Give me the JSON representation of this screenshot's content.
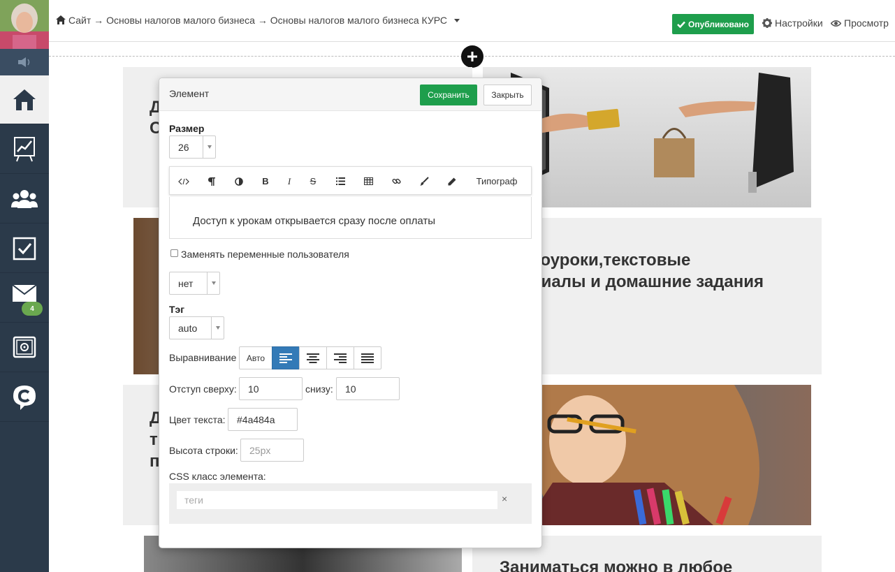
{
  "breadcrumb": {
    "home_icon": "home-icon",
    "path": "Сайт → Основы налогов малого бизнеса → Основы налогов малого бизнеса КУРС"
  },
  "header": {
    "published_label": "Опубликовано",
    "settings_label": "Настройки",
    "preview_label": "Просмотр"
  },
  "sidebar": {
    "mail_badge": "4",
    "items": [
      "home-icon",
      "chart-icon",
      "users-icon",
      "tasks-icon",
      "mail-icon",
      "safe-icon",
      "logo-icon"
    ]
  },
  "page_blocks": {
    "block2_line1": "еоуроки,текстовые",
    "block2_line2": "риалы и домашние задания",
    "block4_line1": "Заниматься можно в любое",
    "block1_letter1": "Д",
    "block1_letter2": "С",
    "block3_letter1": "Д",
    "block3_letter2": "т",
    "block3_letter3": "п"
  },
  "modal": {
    "title": "Элемент",
    "save_label": "Сохранить",
    "close_label": "Закрыть",
    "size_label": "Размер",
    "size_value": "26",
    "toolbar": {
      "typograph_label": "Типограф",
      "buttons": [
        "code-icon",
        "paragraph-icon",
        "contrast-icon",
        "bold-icon",
        "italic-icon",
        "strike-icon",
        "list-icon",
        "table-icon",
        "link-icon",
        "brush-icon",
        "pencil-icon"
      ]
    },
    "editor_text": "Доступ к урокам открывается сразу после оплаты",
    "replace_vars_label": "Заменять переменные пользователя",
    "replace_vars_select": "нет",
    "tag_label": "Тэг",
    "tag_value": "auto",
    "align_label": "Выравнивание",
    "align_auto_label": "Авто",
    "margin_top_label": "Отступ сверху:",
    "margin_top_value": "10",
    "margin_bottom_label": "снизу:",
    "margin_bottom_value": "10",
    "text_color_label": "Цвет текста:",
    "text_color_value": "#4a484a",
    "line_height_label": "Высота строки:",
    "line_height_placeholder": "25px",
    "css_class_label": "CSS класс элемента:",
    "css_class_placeholder": "теги",
    "css_class_clear": "×"
  },
  "colors": {
    "sidebar_bg": "#2b3a4a",
    "success_green": "#1e9e4c",
    "active_blue": "#337ab7",
    "badge_green": "#6aa84f"
  }
}
